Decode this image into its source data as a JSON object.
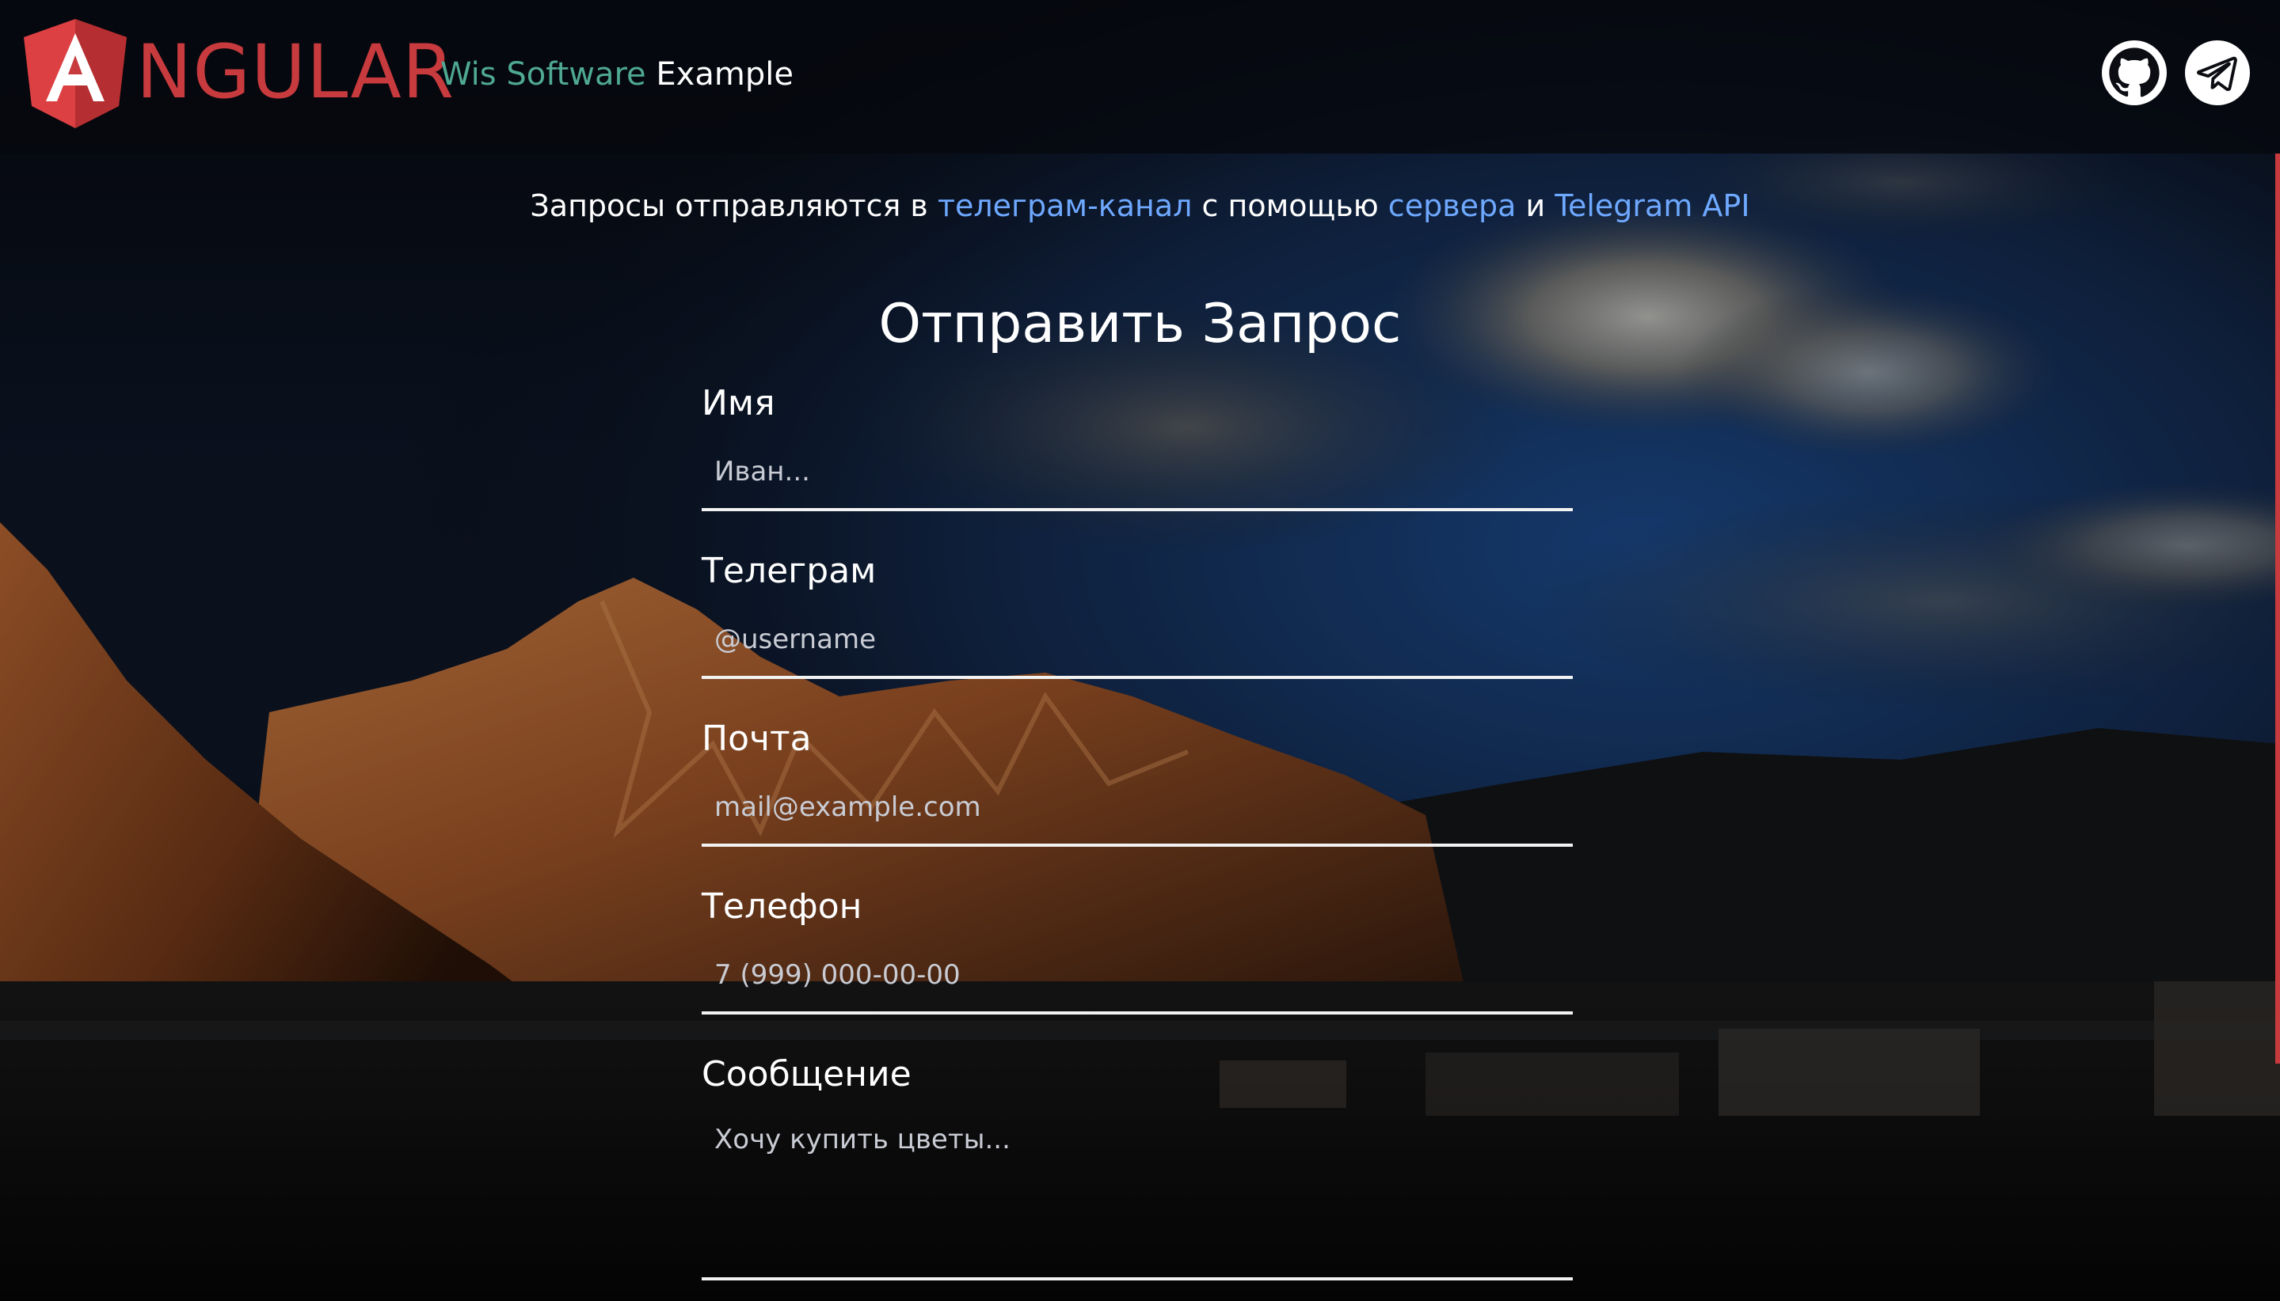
{
  "colors": {
    "brand_red": "#c73a3d",
    "brand_teal": "#4fa893",
    "link_blue": "#6ea8ff",
    "text_white": "#ffffff",
    "header_bg": "#06090f"
  },
  "header": {
    "logo_letter": "A",
    "logo_word": "NGULAR",
    "brand_part1": "Wis Software",
    "brand_part2": "Example",
    "icons": [
      "github-icon",
      "telegram-icon"
    ]
  },
  "info": {
    "prefix": "Запросы отправляются в ",
    "link1": "телеграм-канал",
    "mid1": " с помощью ",
    "link2": "сервера",
    "mid2": " и ",
    "link3": "Telegram API"
  },
  "form": {
    "title": "Отправить Запрос",
    "name_label": "Имя",
    "name_placeholder": "Иван...",
    "telegram_label": "Телеграм",
    "telegram_placeholder": "@username",
    "email_label": "Почта",
    "email_placeholder": "mail@example.com",
    "phone_label": "Телефон",
    "phone_placeholder": "7 (999) 000-00-00",
    "message_label": "Сообщение",
    "message_placeholder": "Хочу купить цветы..."
  }
}
